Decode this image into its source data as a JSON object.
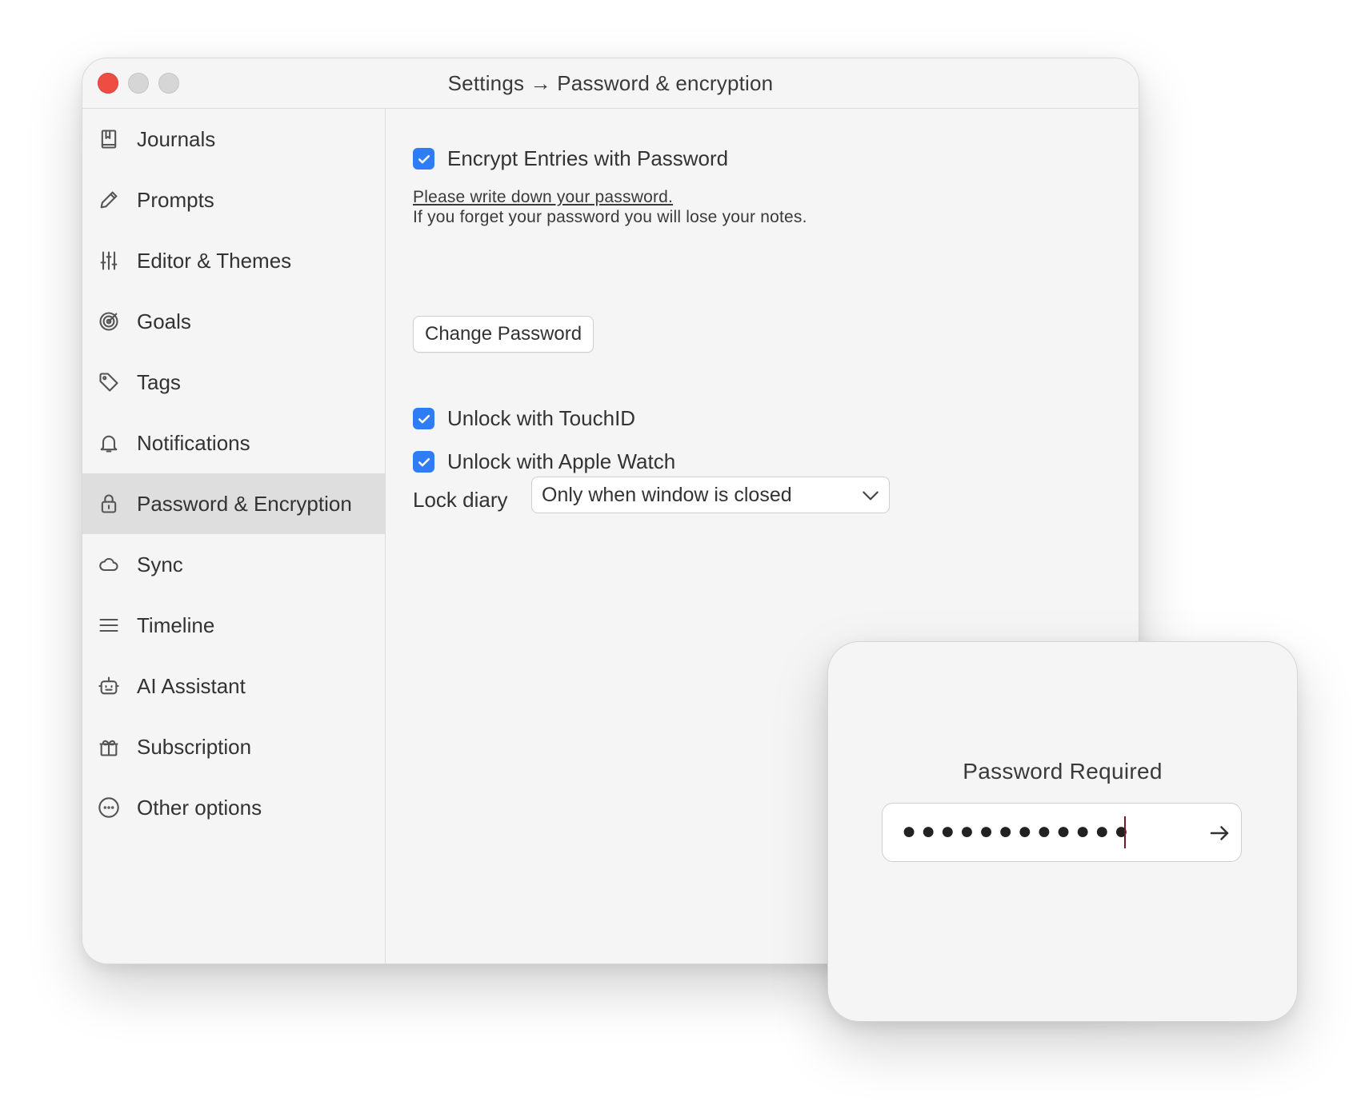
{
  "window": {
    "title": "Settings → Password & encryption"
  },
  "sidebar": {
    "items": [
      {
        "label": "Journals",
        "icon": "journal-icon"
      },
      {
        "label": "Prompts",
        "icon": "pencil-icon"
      },
      {
        "label": "Editor & Themes",
        "icon": "sliders-icon"
      },
      {
        "label": "Goals",
        "icon": "target-icon"
      },
      {
        "label": "Tags",
        "icon": "tag-icon"
      },
      {
        "label": "Notifications",
        "icon": "bell-icon"
      },
      {
        "label": "Password & Encryption",
        "icon": "lock-icon",
        "selected": true
      },
      {
        "label": "Sync",
        "icon": "cloud-icon"
      },
      {
        "label": "Timeline",
        "icon": "list-icon"
      },
      {
        "label": "AI Assistant",
        "icon": "robot-icon"
      },
      {
        "label": "Subscription",
        "icon": "gift-icon"
      },
      {
        "label": "Other options",
        "icon": "more-icon"
      }
    ]
  },
  "content": {
    "encrypt": {
      "label": "Encrypt Entries with Password",
      "checked": true
    },
    "note_link": "Please write down your password.",
    "note_text": "If you forget your password you will lose your notes.",
    "change_password_label": "Change Password",
    "touchid": {
      "label": "Unlock with TouchID",
      "checked": true
    },
    "apple_watch": {
      "label": "Unlock with Apple Watch",
      "checked": true
    },
    "lock_diary": {
      "label": "Lock diary",
      "selected": "Only when window is closed"
    }
  },
  "popup": {
    "title": "Password Required",
    "password_mask": "●●●●●●●●●●●●"
  },
  "colors": {
    "accent": "#2e7cf6",
    "close": "#ef4d43",
    "selected_bg": "#dedede"
  }
}
